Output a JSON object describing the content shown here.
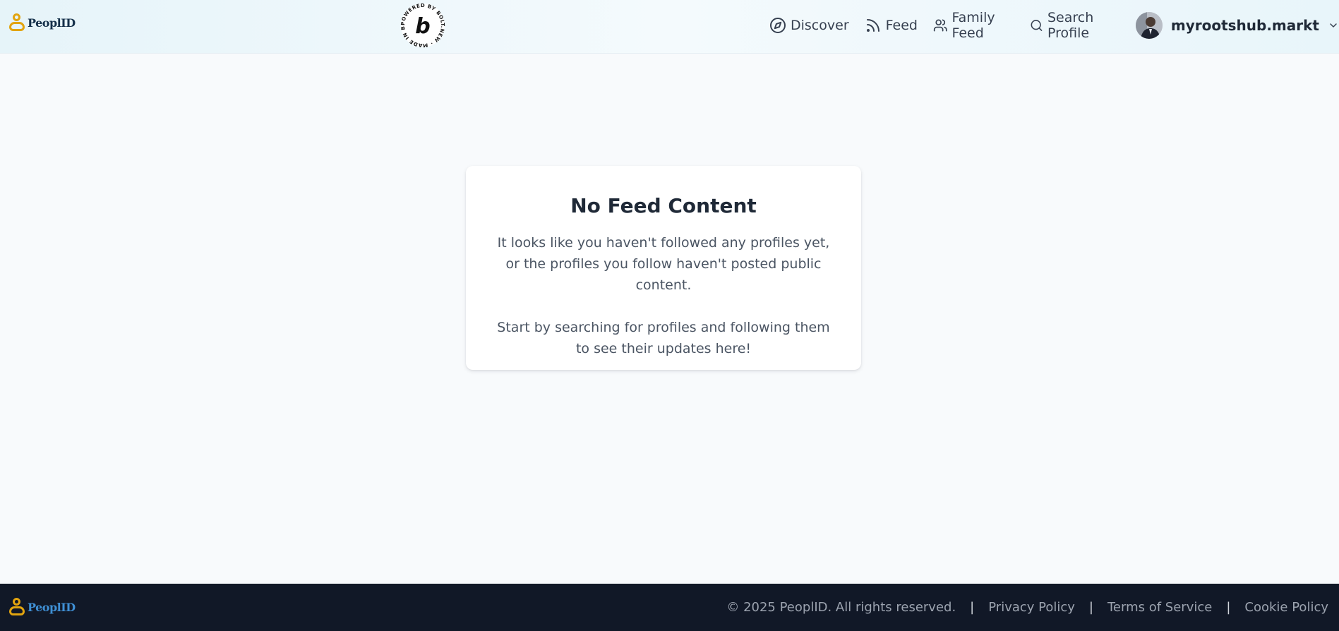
{
  "header": {
    "logo_text": "PeoplID",
    "badge_text": "POWERED BY BOLT.NEW · MADE IN BOLT.NEW ·",
    "badge_letter": "b",
    "nav": [
      {
        "label": "Discover",
        "icon": "compass-icon"
      },
      {
        "label": "Feed",
        "icon": "rss-icon"
      },
      {
        "label": "Family Feed",
        "icon": "users-icon"
      },
      {
        "label": "Search Profile",
        "icon": "search-icon"
      }
    ],
    "user": {
      "name": "myrootshub.markt",
      "icon": "chevron-down-icon"
    }
  },
  "main": {
    "title": "No Feed Content",
    "message_1": "It looks like you haven't followed any profiles yet, or the profiles you follow haven't posted public content.",
    "message_2": "Start by searching for profiles and following them to see their updates here!"
  },
  "footer": {
    "logo_text": "PeoplID",
    "copyright": "© 2025 PeoplID. All rights reserved.",
    "separator": "|",
    "links": [
      "Privacy Policy",
      "Terms of Service",
      "Cookie Policy"
    ]
  },
  "colors": {
    "accent_gold": "#e2a40f",
    "footer_bg": "#111827",
    "page_bg": "#f8fafc"
  }
}
